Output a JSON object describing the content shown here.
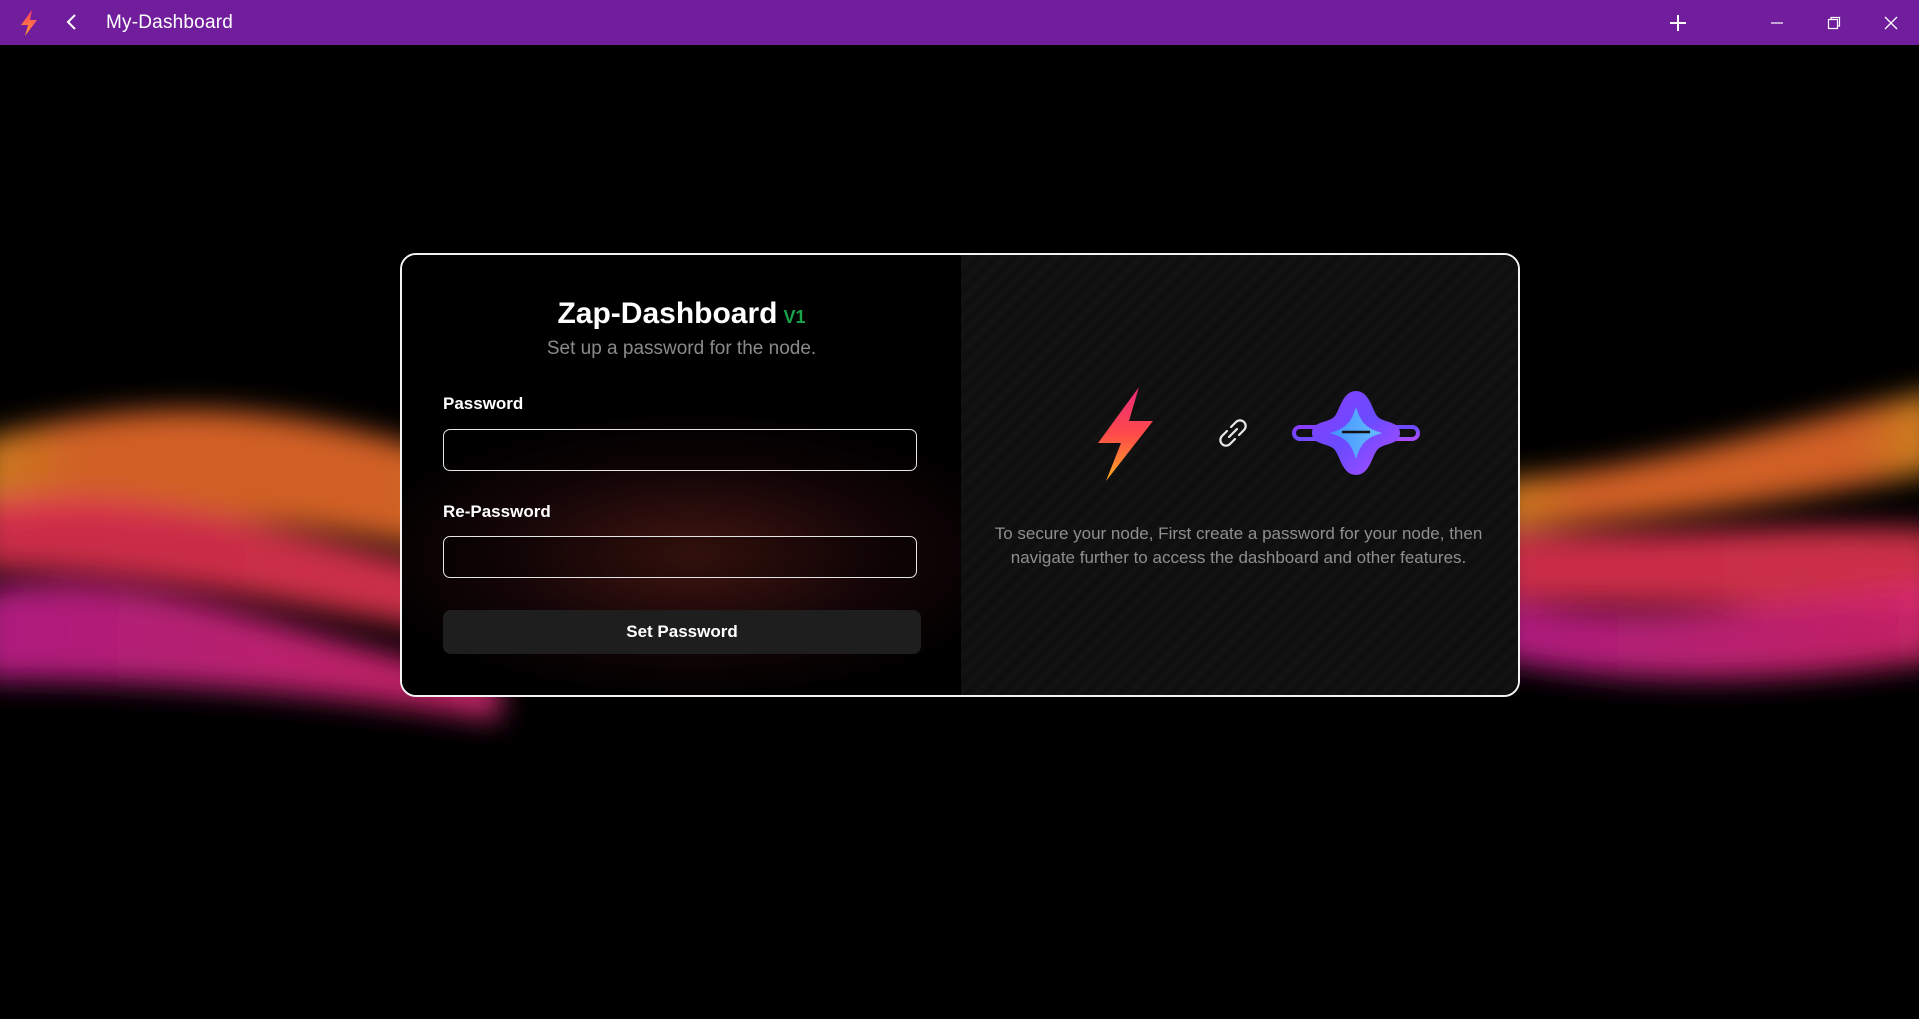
{
  "window": {
    "title": "My-Dashboard",
    "accent_color": "#701e9c",
    "icons": [
      "bolt-logo-icon",
      "back-arrow-icon",
      "add-icon",
      "minimize-icon",
      "restore-icon",
      "close-icon"
    ]
  },
  "card": {
    "title": "Zap-Dashboard",
    "version": "V1",
    "subtitle": "Set up a password for the node.",
    "password_label": "Password",
    "password_value": "",
    "repassword_label": "Re-Password",
    "repassword_value": "",
    "submit_label": "Set Password",
    "description": "To secure your node, First create a password for your node, then navigate further to access the dashboard and other features.",
    "icons": [
      "lightning-bolt-icon",
      "link-icon",
      "node-logo-icon"
    ]
  }
}
